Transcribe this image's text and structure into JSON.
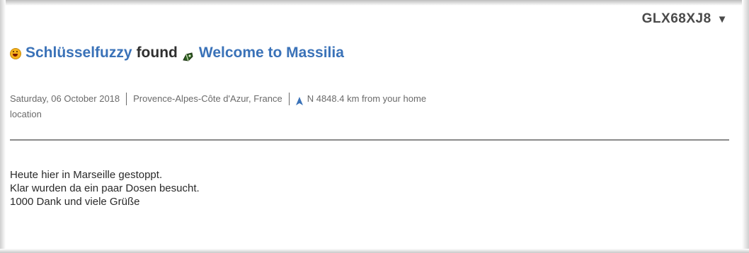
{
  "log_entry": {
    "code": "GLX68XJ8",
    "code_caret": "▼",
    "user": "Schlüsselfuzzy",
    "action": "found",
    "cache_name": "Welcome to Massilia",
    "date": "Saturday, 06 October 2018",
    "region": "Provence-Alpes-Côte d'Azur, France",
    "distance_line1": "N 4848.4 km from your home",
    "distance_line2": "location",
    "text_lines": [
      "Heute hier in Marseille gestoppt.",
      "Klar wurden da ein paar Dosen besucht.",
      "1000 Dank und viele Grüße"
    ],
    "icons": {
      "user_icon": "smiley-face-icon",
      "cache_icon": "traditional-cache-icon",
      "direction_icon": "north-arrow-icon"
    },
    "colors": {
      "link": "#3a72b8",
      "direction": "#3a72b8",
      "divider": "#8a8a8a"
    }
  }
}
